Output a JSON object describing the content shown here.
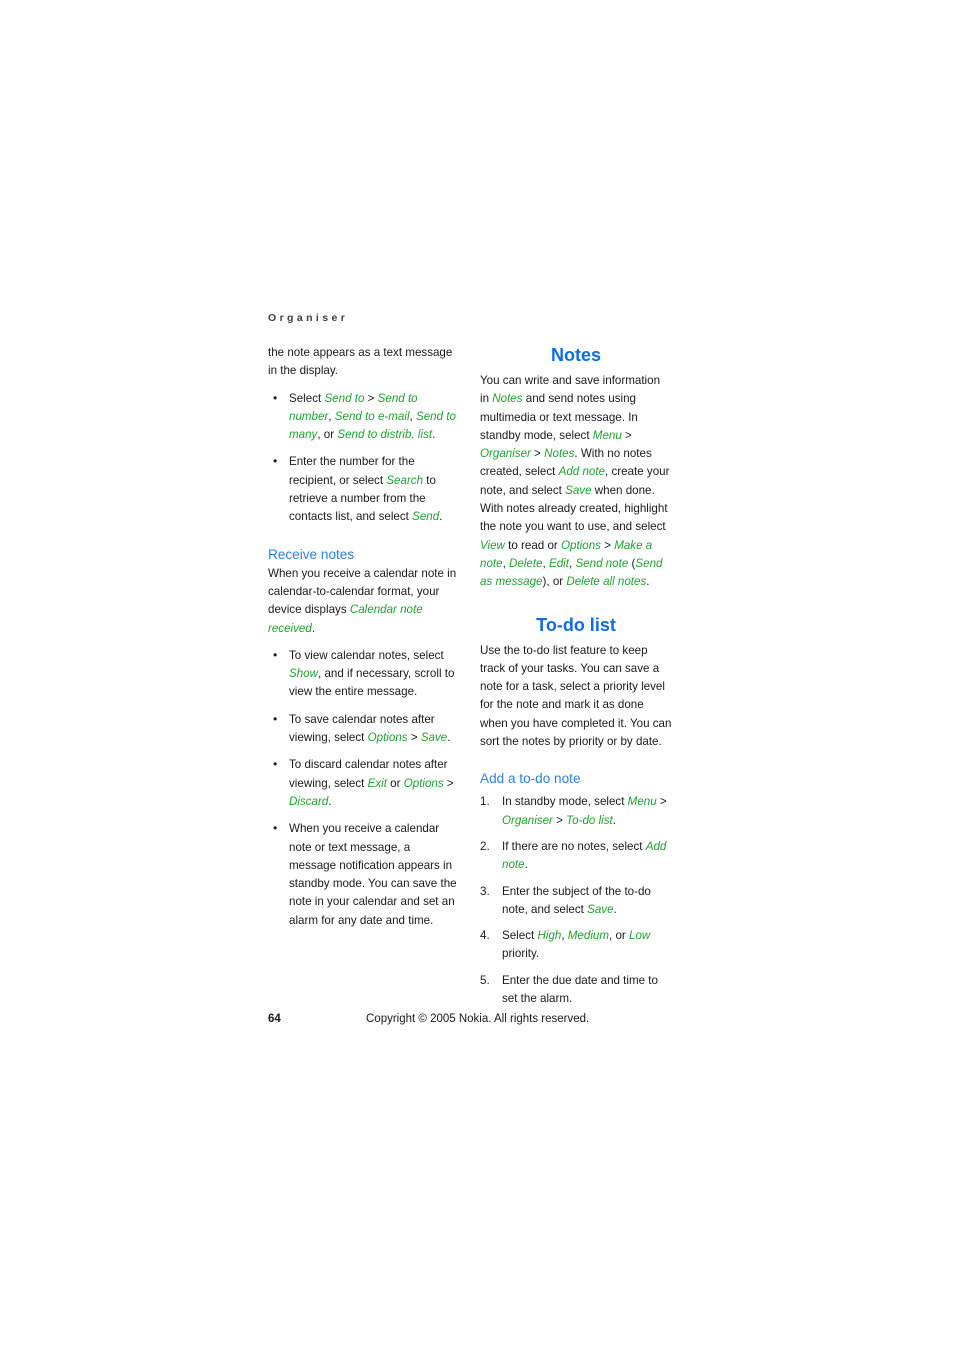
{
  "page": {
    "running_head": "Organiser",
    "folio": "64",
    "copyright": "Copyright © 2005 Nokia. All rights reserved."
  },
  "colors": {
    "heading_primary": "#0f6ce4",
    "heading_secondary": "#2f7fdd",
    "ui_label_green": "#1fa32f",
    "body_text": "#1a1a1a",
    "page_background": "#ffffff"
  },
  "left_column": {
    "continued_paragraph": {
      "t1": "the note appears as a text message in the display."
    },
    "send_bullets": [
      {
        "t1": "Select ",
        "ui1": "Send to",
        "t2": " > ",
        "ui2": "Send to number",
        "t3": ", ",
        "ui3": "Send to e-mail",
        "t4": ", ",
        "ui4": "Send to many",
        "t5": ", or ",
        "ui5": "Send to distrib. list",
        "t6": "."
      },
      {
        "t1": "Enter the number for the recipient, or select ",
        "ui1": "Search",
        "t2": " to retrieve a number from the contacts list, and select ",
        "ui2": "Send",
        "t3": "."
      }
    ],
    "receive_notes": {
      "heading": "Receive notes",
      "intro": {
        "t1": "When you receive a calendar note in calendar-to-calendar format, your device displays ",
        "ui1": "Calendar note received",
        "t2": "."
      },
      "bullets": [
        {
          "t1": "To view calendar notes, select ",
          "ui1": "Show",
          "t2": ", and if necessary, scroll to view the entire message."
        },
        {
          "t1": "To save calendar notes after viewing, select ",
          "ui1": "Options",
          "t2": " > ",
          "ui2": "Save",
          "t3": "."
        },
        {
          "t1": "To discard calendar notes after viewing, select ",
          "ui1": "Exit",
          "t2": " or ",
          "ui2": "Options",
          "t3": " > ",
          "ui3": "Discard",
          "t4": "."
        }
      ],
      "closing_paragraph": {
        "t1": "When you receive a calendar note or text message, a message notification appears in standby mode. You can save the note in your calendar and set an alarm for any date and time."
      }
    }
  },
  "right_column": {
    "notes": {
      "heading": "Notes",
      "paragraph": {
        "t1": "You can write and save information in ",
        "ui1": "Notes",
        "t2": " and send notes using multimedia or text message. In standby mode, select ",
        "ui2": "Menu",
        "t3": " > ",
        "ui3": "Organiser",
        "t4": " > ",
        "ui4": "Notes",
        "t5": ". With no notes created, select ",
        "ui5": "Add note",
        "t6": ", create your note, and select ",
        "ui6": "Save",
        "t7": " when done. With notes already created, highlight the note you want to use, and select ",
        "ui7": "View",
        "t8": " to read or ",
        "ui8": "Options",
        "t9": " > ",
        "ui9": "Make a note",
        "t10": ", ",
        "ui10": "Delete",
        "t11": ", ",
        "ui11": "Edit",
        "t12": ", ",
        "ui12": "Send note",
        "t13": " (",
        "ui13": "Send as message",
        "t14": "), or ",
        "ui14": "Delete all notes",
        "t15": "."
      }
    },
    "todo_list": {
      "heading": "To-do list",
      "paragraph": {
        "t1": "Use the to-do list feature to keep track of your tasks. You can save a note for a task, select a priority level for the note and mark it as done when you have completed it. You can sort the notes by priority or by date."
      }
    },
    "add_todo_note": {
      "heading": "Add a to-do note",
      "steps": [
        {
          "t1": "In standby mode, select ",
          "ui1": "Menu",
          "t2": " > ",
          "ui2": "Organiser",
          "t3": " > ",
          "ui3": "To-do list",
          "t4": "."
        },
        {
          "t1": "If there are no notes, select ",
          "ui1": "Add note",
          "t2": "."
        },
        {
          "t1": "Enter the subject of the to-do note, and select ",
          "ui1": "Save",
          "t2": "."
        },
        {
          "t1": "Select ",
          "ui1": "High",
          "t2": ", ",
          "ui2": "Medium",
          "t3": ", or ",
          "ui3": "Low",
          "t4": " priority."
        },
        {
          "t1": "Enter the due date and time to set the alarm."
        }
      ]
    }
  }
}
